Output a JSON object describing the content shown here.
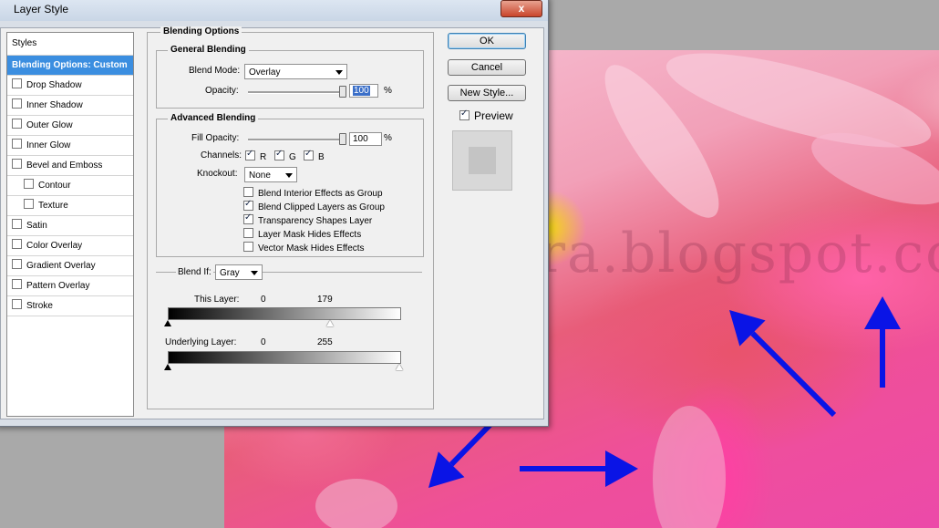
{
  "window": {
    "title": "Layer Style",
    "close_label": "x"
  },
  "styles_list": {
    "header": "Styles",
    "items": [
      {
        "label": "Blending Options: Custom",
        "selected": true,
        "checkbox": false,
        "checked": false,
        "indent": false
      },
      {
        "label": "Drop Shadow",
        "checkbox": true,
        "checked": false,
        "indent": false
      },
      {
        "label": "Inner Shadow",
        "checkbox": true,
        "checked": false,
        "indent": false
      },
      {
        "label": "Outer Glow",
        "checkbox": true,
        "checked": false,
        "indent": false
      },
      {
        "label": "Inner Glow",
        "checkbox": true,
        "checked": false,
        "indent": false
      },
      {
        "label": "Bevel and Emboss",
        "checkbox": true,
        "checked": false,
        "indent": false
      },
      {
        "label": "Contour",
        "checkbox": true,
        "checked": false,
        "indent": true
      },
      {
        "label": "Texture",
        "checkbox": true,
        "checked": false,
        "indent": true
      },
      {
        "label": "Satin",
        "checkbox": true,
        "checked": false,
        "indent": false
      },
      {
        "label": "Color Overlay",
        "checkbox": true,
        "checked": false,
        "indent": false
      },
      {
        "label": "Gradient Overlay",
        "checkbox": true,
        "checked": false,
        "indent": false
      },
      {
        "label": "Pattern Overlay",
        "checkbox": true,
        "checked": false,
        "indent": false
      },
      {
        "label": "Stroke",
        "checkbox": true,
        "checked": false,
        "indent": false
      }
    ]
  },
  "blending": {
    "section_title": "Blending Options",
    "general": {
      "title": "General Blending",
      "blend_mode_label": "Blend Mode:",
      "blend_mode_value": "Overlay",
      "opacity_label": "Opacity:",
      "opacity_value": "100",
      "opacity_unit": "%",
      "opacity_fraction": 1.0
    },
    "advanced": {
      "title": "Advanced Blending",
      "fill_opacity_label": "Fill Opacity:",
      "fill_opacity_value": "100",
      "fill_opacity_unit": "%",
      "fill_opacity_fraction": 1.0,
      "channels_label": "Channels:",
      "channels": [
        {
          "label": "R",
          "checked": true
        },
        {
          "label": "G",
          "checked": true
        },
        {
          "label": "B",
          "checked": true
        }
      ],
      "knockout_label": "Knockout:",
      "knockout_value": "None",
      "options": [
        {
          "label": "Blend Interior Effects as Group",
          "checked": false
        },
        {
          "label": "Blend Clipped Layers as Group",
          "checked": true
        },
        {
          "label": "Transparency Shapes Layer",
          "checked": true
        },
        {
          "label": "Layer Mask Hides Effects",
          "checked": false
        },
        {
          "label": "Vector Mask Hides Effects",
          "checked": false
        }
      ]
    },
    "blend_if": {
      "label": "Blend If:",
      "value": "Gray",
      "this_layer": {
        "label": "This Layer:",
        "low": "0",
        "high": "179",
        "low_level": 0,
        "high_level": 179
      },
      "underlying_layer": {
        "label": "Underlying Layer:",
        "low": "0",
        "high": "255",
        "low_level": 0,
        "high_level": 255
      }
    }
  },
  "buttons": {
    "ok": "OK",
    "cancel": "Cancel",
    "new_style": "New Style...",
    "preview_label": "Preview",
    "preview_checked": true
  },
  "canvas": {
    "watermark": "ariadianpera.blogspot.com",
    "arrow_color": "#0a14e6"
  }
}
